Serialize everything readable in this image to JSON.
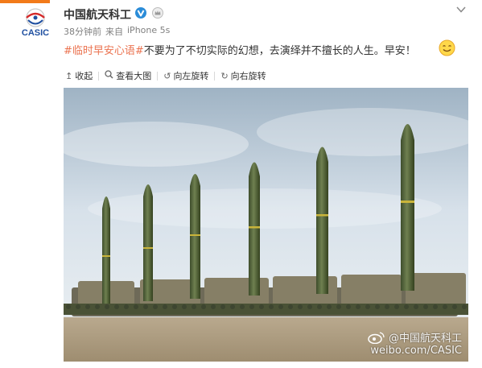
{
  "post": {
    "username": "中国航天科工",
    "logo_text": "CASIC",
    "time": "38分钟前",
    "source_prefix": "来自",
    "source_device": "iPhone 5s",
    "hashtag": "#临时早安心语#",
    "text": "不要为了不切实际的幻想，去演绎并不擅长的人生。早安！"
  },
  "toolbar": {
    "collapse": "收起",
    "view_large": "查看大图",
    "rotate_left": "向左旋转",
    "rotate_right": "向右旋转"
  },
  "image": {
    "watermark_handle": "@中国航天科工",
    "watermark_url": "weibo.com/CASIC"
  },
  "colors": {
    "accent": "#eb7350",
    "top_bar": "#f27a1a",
    "verified": "#2b8cd8"
  },
  "icons": {
    "verified": "verified-v-icon",
    "member": "crown-icon",
    "emoji": "smile-emoji-icon"
  }
}
